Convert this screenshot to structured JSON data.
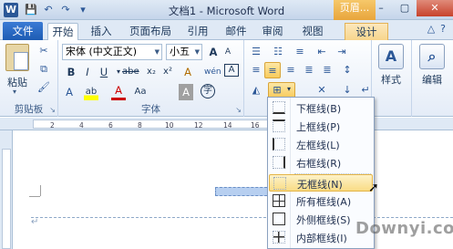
{
  "app": {
    "icon_letter": "W",
    "title": "文档1 - Microsoft Word",
    "header_ctx": "页眉...",
    "window_buttons": [
      "–",
      "▢",
      "✕"
    ]
  },
  "qat": [
    "💾",
    "↶",
    "↷",
    "▾"
  ],
  "tabs": {
    "file": "文件",
    "items": [
      "开始",
      "插入",
      "页面布局",
      "引用",
      "邮件",
      "审阅",
      "视图"
    ],
    "design": "设计"
  },
  "help_icons": [
    "△",
    "?"
  ],
  "clipboard": {
    "paste_label": "粘贴",
    "group_label": "剪贴板"
  },
  "font": {
    "family": "宋体 (中文正文)",
    "size": "小五",
    "grow": "A",
    "shrink": "A",
    "aa": "Aa",
    "clear": "A",
    "wen": "wén",
    "A_box": "A",
    "bold": "B",
    "italic": "I",
    "underline": "U",
    "strike": "abe",
    "sub": "x₂",
    "sup": "x²",
    "font_color": "A",
    "char_shade": "A",
    "char_border": "A",
    "circled": "字",
    "group_label": "字体"
  },
  "styles": {
    "label": "样式"
  },
  "editing": {
    "label": "编辑"
  },
  "ruler_numbers": [
    "2",
    "4",
    "6",
    "8",
    "10",
    "12",
    "14",
    "16"
  ],
  "menu": {
    "items": [
      {
        "label": "下框线(B)",
        "icon": "bottom"
      },
      {
        "label": "上框线(P)",
        "icon": "top"
      },
      {
        "label": "左框线(L)",
        "icon": "left"
      },
      {
        "label": "右框线(R)",
        "icon": "right"
      },
      {
        "label": "无框线(N)",
        "icon": "none"
      },
      {
        "label": "所有框线(A)",
        "icon": "all"
      },
      {
        "label": "外侧框线(S)",
        "icon": "outer"
      },
      {
        "label": "内部框线(I)",
        "icon": "inner"
      }
    ],
    "hover_index": 4
  },
  "doc": {
    "para_mark": "↵"
  },
  "watermark": "Downyi.com"
}
